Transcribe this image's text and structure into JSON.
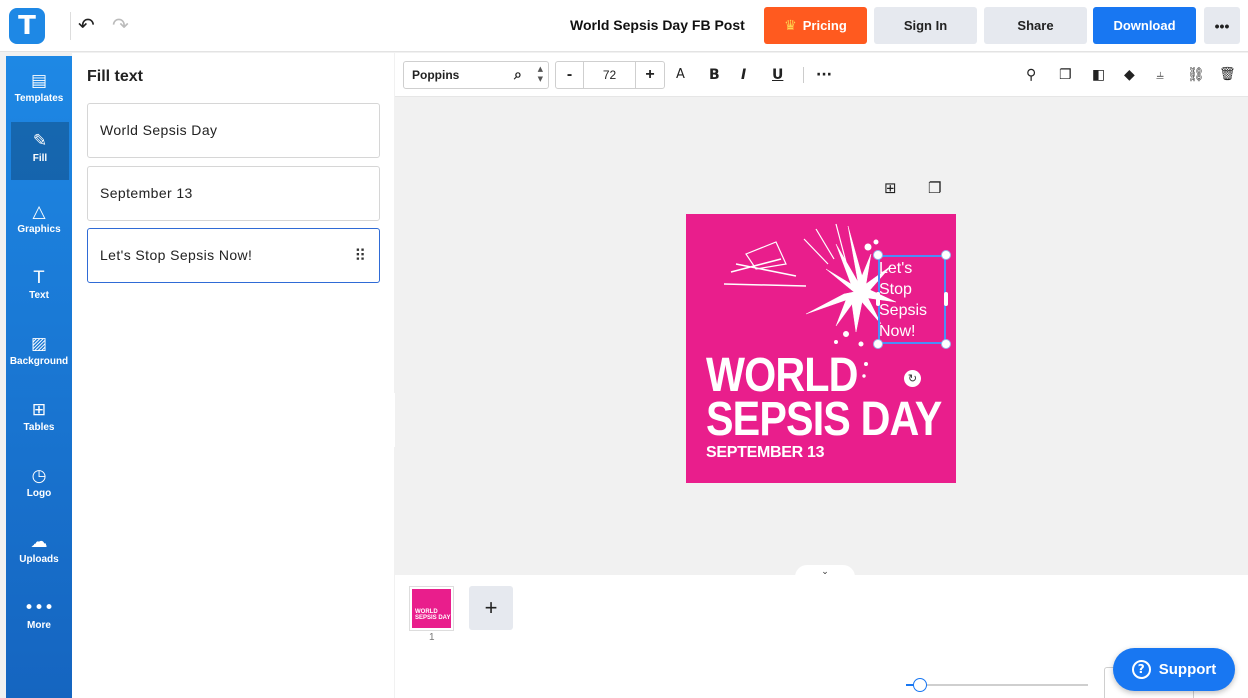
{
  "app": {
    "logo_letter": "T",
    "doc_title": "World Sepsis Day FB Post"
  },
  "header": {
    "undo_icon": "↶",
    "redo_icon": "↷",
    "pricing": "Pricing",
    "sign_in": "Sign In",
    "share": "Share",
    "download": "Download",
    "more": "•••"
  },
  "sidebar": {
    "items": [
      {
        "icon": "▤",
        "label": "Templates"
      },
      {
        "icon": "✎",
        "label": "Fill"
      },
      {
        "icon": "△",
        "label": "Graphics"
      },
      {
        "icon": "T",
        "label": "Text"
      },
      {
        "icon": "▨",
        "label": "Background"
      },
      {
        "icon": "⊞",
        "label": "Tables"
      },
      {
        "icon": "◷",
        "label": "Logo"
      },
      {
        "icon": "☁",
        "label": "Uploads"
      },
      {
        "icon": "•••",
        "label": "More"
      }
    ]
  },
  "panel": {
    "title": "Fill text",
    "fields": [
      {
        "value": "World Sepsis Day"
      },
      {
        "value": "September 13"
      },
      {
        "value": "Let's Stop Sepsis Now!"
      }
    ],
    "drag_icon": "⠿"
  },
  "format_toolbar": {
    "font": "Poppins",
    "search_icon": "⌕",
    "size_minus": "-",
    "size": "72",
    "size_plus": "+",
    "case": "A",
    "bold": "B",
    "italic": "I",
    "underline": "U",
    "more": "···",
    "tool_icons": [
      "⚲",
      "❐",
      "◧",
      "◆",
      "⫨",
      "⛓",
      "🗑"
    ]
  },
  "canvas": {
    "float_icons": [
      "⊞",
      "❐"
    ],
    "poster": {
      "line1": "WORLD",
      "line2": "SEPSIS DAY",
      "date": "SEPTEMBER 13",
      "tagline": "Let's Stop Sepsis Now!",
      "background": "#e91e8c"
    },
    "collapse_icon": "‹",
    "bottom_toggle_icon": "⌄"
  },
  "pages": {
    "thumb_line1": "WORLD",
    "thumb_line2": "SEPSIS DAY",
    "page_number": "1",
    "add_page": "+"
  },
  "support": {
    "icon": "?",
    "label": "Support"
  },
  "colors": {
    "accent": "#1877f2",
    "pricing": "#ff5a1f",
    "sidebar": "#1e88e5",
    "poster": "#e91e8c"
  }
}
